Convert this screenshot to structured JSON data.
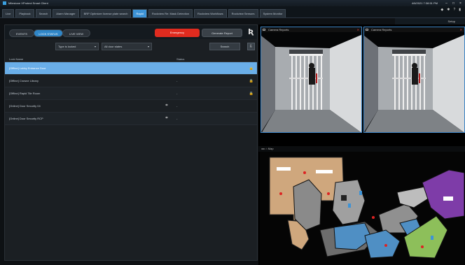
{
  "window": {
    "title": "Milestone XProtect Smart Client",
    "datetime": "4/6/2021 7:38:51 PM"
  },
  "tabs": [
    {
      "label": "Live",
      "active": false
    },
    {
      "label": "Playback",
      "active": false
    },
    {
      "label": "Search",
      "active": false
    },
    {
      "label": "Alarm Manager",
      "active": false
    },
    {
      "label": "BRP Optimizer license plate search",
      "active": false
    },
    {
      "label": "Rapid",
      "active": true
    },
    {
      "label": "Rockview Re: Mask Detection",
      "active": false
    },
    {
      "label": "Rockview Workflows",
      "active": false
    },
    {
      "label": "Rockview Sensors",
      "active": false
    },
    {
      "label": "System Monitor",
      "active": false
    }
  ],
  "subbar": {
    "setup_label": "Setup"
  },
  "panel": {
    "views": [
      "EVENTS",
      "LOCK STATUS",
      "LIVE VIEW"
    ],
    "emergency_label": "Emergency",
    "generate_report_label": "Generate Report",
    "filter_type": "Type is locked",
    "filter_doors": "All door states",
    "search_label": "Search",
    "columns": {
      "name": "Lock Name",
      "state": "Status"
    },
    "rows": [
      {
        "name": "[Offline] Lobby Entrance Door",
        "state": "",
        "selected": true,
        "has_icon": false
      },
      {
        "name": "[Offline] Crowne Library",
        "state": "-",
        "selected": false,
        "has_icon": false
      },
      {
        "name": "[Offline] Rapid Tile Room",
        "state": "-",
        "selected": false,
        "has_icon": false
      },
      {
        "name": "[Online] Door Security 04",
        "state": "-",
        "selected": false,
        "has_icon": true
      },
      {
        "name": "[Online] Door Security RCP",
        "state": "-",
        "selected": false,
        "has_icon": true
      }
    ]
  },
  "cameras": [
    {
      "label": "Camera Reports"
    },
    {
      "label": "Camera Reports"
    }
  ],
  "map": {
    "title": "Map"
  },
  "colors": {
    "accent": "#3d93d6",
    "selected_row": "#6aaee8",
    "emergency": "#e02b1f",
    "map_tan": "#cfa77d",
    "map_blue": "#4f8fc4",
    "map_green": "#8dbf5a",
    "map_purple": "#7e3ca8"
  }
}
